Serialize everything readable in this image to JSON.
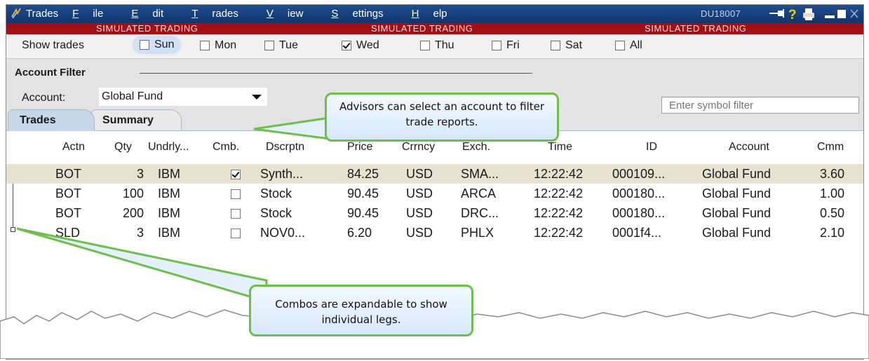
{
  "titlebar": {
    "app_name": "Trades",
    "menu": [
      {
        "label": "File",
        "ul": "F",
        "rest": "ile"
      },
      {
        "label": "Edit",
        "ul": "E",
        "rest": "dit"
      },
      {
        "label": "Trades",
        "ul": "T",
        "rest": "rades"
      },
      {
        "label": "View",
        "ul": "V",
        "rest": "iew"
      },
      {
        "label": "Settings",
        "ul": "S",
        "rest": "ettings"
      },
      {
        "label": "Help",
        "ul": "H",
        "rest": "elp"
      }
    ],
    "account_id": "DU18007",
    "icons": [
      "pin-icon",
      "help-icon",
      "print-icon",
      "minimize-icon",
      "maximize-icon",
      "close-icon"
    ]
  },
  "sim_banner": [
    "SIMULATED TRADING",
    "SIMULATED TRADING",
    "SIMULATED TRADING"
  ],
  "show_trades": {
    "label": "Show trades",
    "days": [
      {
        "label": "Sun",
        "checked": false,
        "highlighted": true
      },
      {
        "label": "Mon",
        "checked": false
      },
      {
        "label": "Tue",
        "checked": false
      },
      {
        "label": "Wed",
        "checked": true
      },
      {
        "label": "Thu",
        "checked": false
      },
      {
        "label": "Fri",
        "checked": false
      },
      {
        "label": "Sat",
        "checked": false
      },
      {
        "label": "All",
        "checked": false
      }
    ]
  },
  "account_filter": {
    "title": "Account Filter",
    "account_label": "Account:",
    "selected_account": "Global Fund"
  },
  "symbol_filter": {
    "placeholder": "Enter symbol filter"
  },
  "tabs": [
    {
      "label": "Trades",
      "active": true
    },
    {
      "label": "Summary",
      "active": false
    }
  ],
  "table": {
    "columns": [
      "Actn",
      "Qty",
      "Undrly...",
      "Cmb.",
      "Dscrptn",
      "Price",
      "Crrncy",
      "Exch.",
      "Time",
      "ID",
      "Account",
      "Cmm"
    ],
    "rows": [
      {
        "actn": "BOT",
        "qty": "3",
        "undrly": "IBM",
        "cmb": true,
        "desc": "Synth...",
        "price": "84.25",
        "crrncy": "USD",
        "exch": "SMA...",
        "time": "12:22:42",
        "id": "000109...",
        "account": "Global Fund",
        "cmm": "3.60"
      },
      {
        "actn": "BOT",
        "qty": "100",
        "undrly": "IBM",
        "cmb": false,
        "desc": "Stock",
        "price": "90.45",
        "crrncy": "USD",
        "exch": "ARCA",
        "time": "12:22:42",
        "id": "000180...",
        "account": "Global Fund",
        "cmm": "1.00"
      },
      {
        "actn": "BOT",
        "qty": "200",
        "undrly": "IBM",
        "cmb": false,
        "desc": "Stock",
        "price": "90.45",
        "crrncy": "USD",
        "exch": "DRC...",
        "time": "12:22:42",
        "id": "000180...",
        "account": "Global Fund",
        "cmm": "0.50"
      },
      {
        "actn": "SLD",
        "qty": "3",
        "undrly": "IBM",
        "cmb": false,
        "desc": "NOV0...",
        "price": "6.20",
        "crrncy": "USD",
        "exch": "PHLX",
        "time": "12:22:42",
        "id": "0001f4...",
        "account": "Global Fund",
        "cmm": "2.10"
      }
    ]
  },
  "callouts": {
    "account": "Advisors can select an account to filter trade reports.",
    "combos": "Combos are expandable to show individual legs."
  },
  "colors": {
    "titlebar": "#1b4585",
    "sim_banner": "#a20f14",
    "selected_row": "#e6e2cf",
    "callout_border": "#6cc04a",
    "tab_active": "#c7d7ea"
  }
}
